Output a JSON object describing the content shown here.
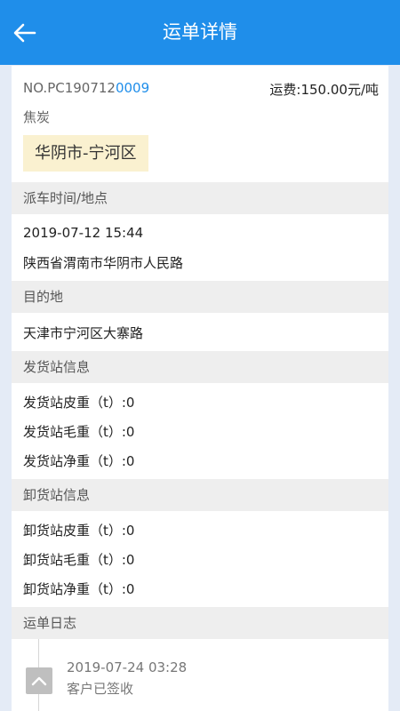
{
  "header": {
    "title": "运单详情"
  },
  "order": {
    "no_prefix": "NO.PC190712",
    "no_suffix": "0009",
    "fee": "运费:150.00元/吨",
    "cargo": "焦炭",
    "route": "华阴市-宁河区"
  },
  "dispatch": {
    "section": "派车时间/地点",
    "time": "2019-07-12 15:44",
    "address": "陕西省渭南市华阴市人民路"
  },
  "destination": {
    "section": "目的地",
    "address": "天津市宁河区大寨路"
  },
  "shipping_station": {
    "section": "发货站信息",
    "tare": "发货站皮重（t）:0",
    "gross": "发货站毛重（t）:0",
    "net": "发货站净重（t）:0"
  },
  "unloading_station": {
    "section": "卸货站信息",
    "tare": "卸货站皮重（t）:0",
    "gross": "卸货站毛重（t）:0",
    "net": "卸货站净重（t）:0"
  },
  "log": {
    "section": "运单日志",
    "entries": [
      {
        "time": "2019-07-24 03:28",
        "text": "客户已签收"
      }
    ]
  },
  "icons": {
    "back": "back-arrow-icon",
    "collapse": "chevron-up-icon"
  }
}
